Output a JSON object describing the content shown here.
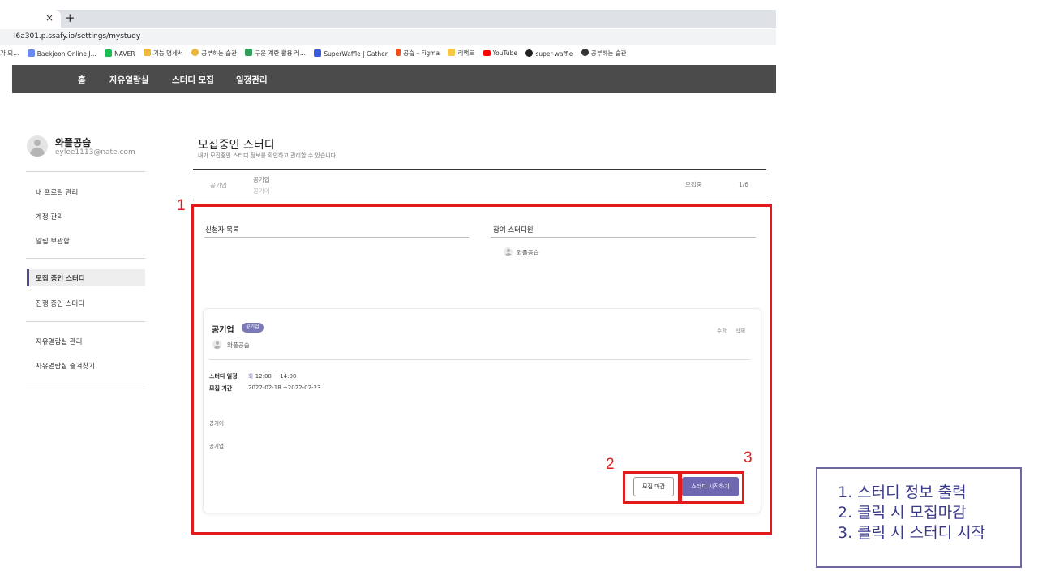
{
  "browser": {
    "close_tab": "×",
    "new_tab": "+",
    "url": "i6a301.p.ssafy.io/settings/mystudy",
    "bookmarks": [
      {
        "label": "가 되...",
        "color": "#9aa0a6",
        "icon": "none"
      },
      {
        "label": "Baekjoon Online J...",
        "color": "#6b8af0",
        "icon": "code-icon"
      },
      {
        "label": "NAVER",
        "color": "#19c04f",
        "icon": "naver-icon"
      },
      {
        "label": "기능 명세서",
        "color": "#f0b93d",
        "icon": "doc-icon"
      },
      {
        "label": "공부하는 습관",
        "color": "#e8b63a",
        "icon": "emoji-icon"
      },
      {
        "label": "구운 계란 활용 레...",
        "color": "#2f9e5b",
        "icon": "page-icon"
      },
      {
        "label": "SuperWaffle | Gather",
        "color": "#3b5bdb",
        "icon": "gather-icon"
      },
      {
        "label": "공습 – Figma",
        "color": "#f24e1e",
        "icon": "figma-icon"
      },
      {
        "label": "리액트",
        "color": "#f6c64a",
        "icon": "folder-icon"
      },
      {
        "label": "YouTube",
        "color": "#ff0000",
        "icon": "youtube-icon"
      },
      {
        "label": "super-waffle",
        "color": "#222222",
        "icon": "github-icon"
      },
      {
        "label": "공부하는 습관",
        "color": "#333333",
        "icon": "globe-icon"
      }
    ]
  },
  "nav": {
    "home": "홈",
    "reading_room": "자유열람실",
    "recruit": "스터디 모집",
    "schedule": "일정관리"
  },
  "profile": {
    "name": "와플공습",
    "email": "eylee1113@nate.com"
  },
  "sidebar": {
    "profile_manage": "내 프로필 관리",
    "account_manage": "계정 관리",
    "notifications": "알림 보관함",
    "recruiting": "모집 중인 스터디",
    "in_progress": "진행 중인 스터디",
    "room_manage": "자유열람실 관리",
    "room_favorites": "자유열람실 즐겨찾기"
  },
  "main": {
    "title": "모집중인 스터디",
    "description": "내가 모집중인 스터디 정보를 확인하고 관리할 수 있습니다",
    "summary": {
      "category": "공기업",
      "name": "공기업",
      "subtitle": "공기어",
      "status": "모집중",
      "count": "1/6"
    },
    "applicants_header": "신청자 목록",
    "members_header": "참여 스터디원",
    "member_name": "와플공습",
    "card": {
      "title": "공기업",
      "badge": "공기업",
      "edit": "수정",
      "delete": "삭제",
      "leader": "와플공습",
      "schedule_label": "스터디 일정",
      "schedule_day": "화",
      "schedule_time": "12:00 ~ 14:00",
      "period_label": "모집 기간",
      "period_value": "2022-02-18 ~2022-02-23",
      "text1": "공기어",
      "text2": "공기업",
      "close_button": "모집 마감",
      "start_button": "스터디 시작하기"
    }
  },
  "annotations": {
    "num1": "1",
    "num2": "2",
    "num3": "3",
    "legend": [
      "1. 스터디 정보 출력",
      "2. 클릭 시 모집마감",
      "3. 클릭 시 스터디 시작"
    ],
    "color": "#e11b1b"
  }
}
